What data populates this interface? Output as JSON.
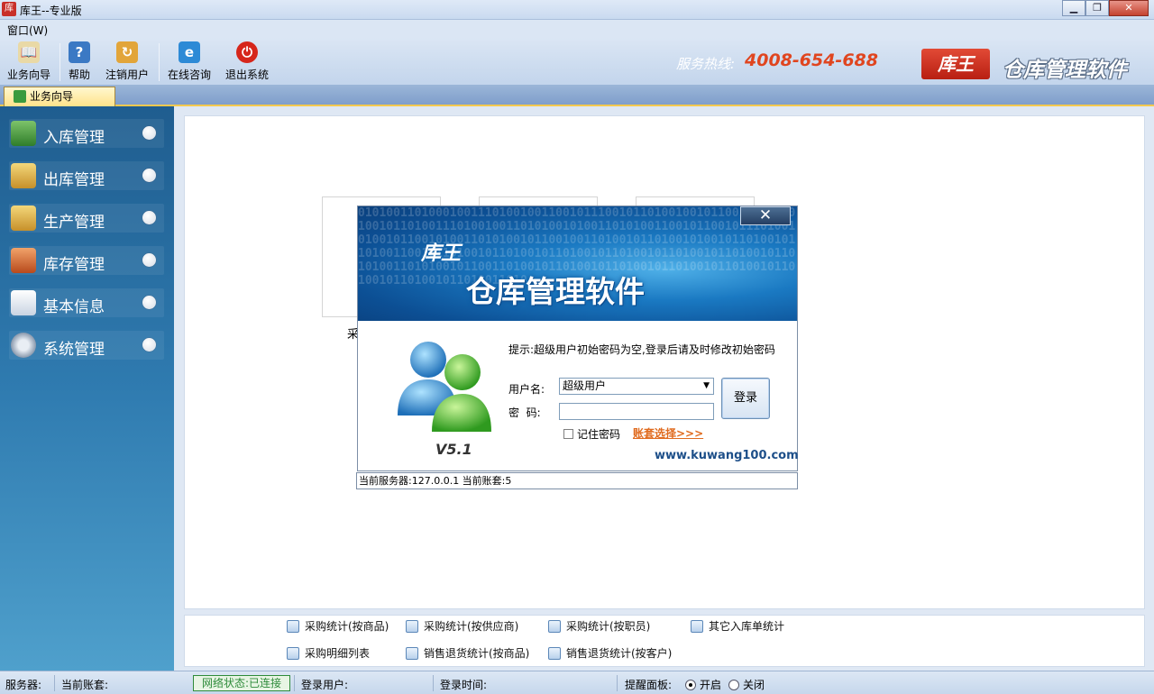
{
  "window": {
    "title": "库王--专业版",
    "app_icon": "库"
  },
  "menu": {
    "window_menu": "窗口(W)"
  },
  "toolbar": {
    "items": [
      {
        "label": "业务向导",
        "icon": "book-icon"
      },
      {
        "label": "帮助",
        "icon": "help-icon"
      },
      {
        "label": "注销用户",
        "icon": "logout-user-icon"
      },
      {
        "label": "在线咨询",
        "icon": "ie-icon"
      },
      {
        "label": "退出系统",
        "icon": "power-icon"
      }
    ],
    "hotline_label": "服务热线:",
    "hotline_number": "4008-654-688",
    "brand_logo": "库王",
    "brand_text": "仓库管理软件"
  },
  "tabs": [
    {
      "label": "业务向导",
      "active": true
    }
  ],
  "sidebar": {
    "items": [
      {
        "label": "入库管理",
        "icon": "inbound-icon"
      },
      {
        "label": "出库管理",
        "icon": "outbound-icon"
      },
      {
        "label": "生产管理",
        "icon": "production-icon"
      },
      {
        "label": "库存管理",
        "icon": "warehouse-icon"
      },
      {
        "label": "基本信息",
        "icon": "contact-card-icon"
      },
      {
        "label": "系统管理",
        "icon": "settings-icon"
      }
    ]
  },
  "main": {
    "card_caption": "采"
  },
  "quick_links": [
    "采购统计(按商品)",
    "采购统计(按供应商)",
    "采购统计(按职员)",
    "其它入库单统计",
    "采购明细列表",
    "销售退货统计(按商品)",
    "销售退货统计(按客户)"
  ],
  "login": {
    "close": "✕",
    "banner_logo": "库王",
    "banner_title": "仓库管理软件",
    "version": "V5.1",
    "hint": "提示:超级用户初始密码为空,登录后请及时修改初始密码",
    "username_label": "用户名:",
    "username_value": "超级用户",
    "password_label": "密  码:",
    "password_value": "",
    "remember_label": "记住密码",
    "account_link": "账套选择>>>",
    "login_button": "登录",
    "website": "www.kuwang100.com",
    "server_info": "当前服务器:127.0.0.1  当前账套:5"
  },
  "statusbar": {
    "server_label": "服务器:",
    "account_label": "当前账套:",
    "network_status": "网络状态:已连接",
    "login_user_label": "登录用户:",
    "login_time_label": "登录时间:",
    "reminder_label": "提醒面板:",
    "reminder_on": "开启",
    "reminder_off": "关闭",
    "reminder_selected": "开启"
  },
  "colors": {
    "accent": "#e0451f",
    "sidebar": "#2f7bb0",
    "network_ok": "#2e8b3a"
  }
}
